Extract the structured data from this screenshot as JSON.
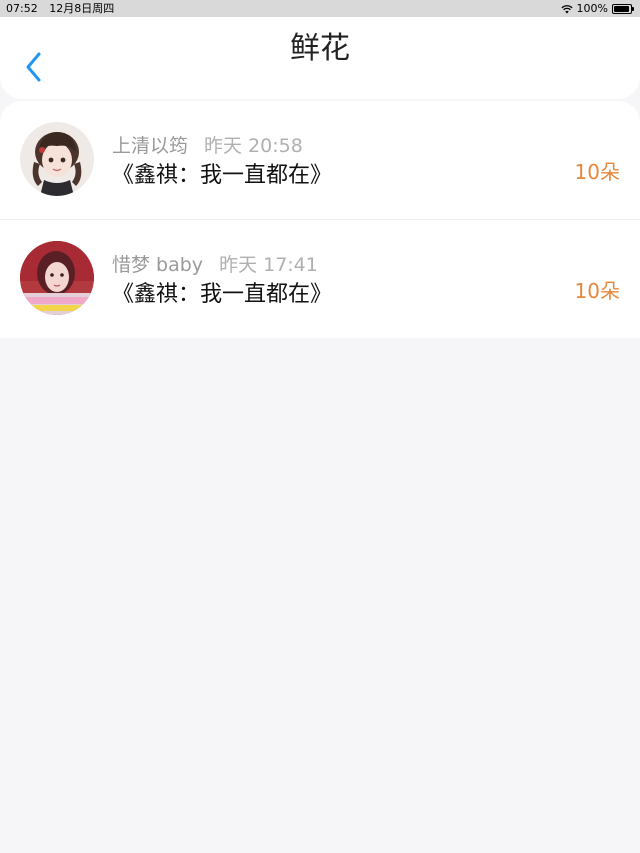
{
  "status_bar": {
    "time": "07:52",
    "date": "12月8日周四",
    "battery": "100%"
  },
  "nav": {
    "title": "鲜花",
    "back_icon": "chevron-left-icon",
    "accent_color": "#2196f3"
  },
  "flowers": [
    {
      "user": "上清以筠",
      "time": "昨天 20:58",
      "title": "《鑫祺：我一直都在》",
      "count": "10朵"
    },
    {
      "user": "惜梦 baby",
      "time": "昨天 17:41",
      "title": "《鑫祺：我一直都在》",
      "count": "10朵"
    }
  ],
  "colors": {
    "count_text": "#e8863a",
    "background": "#f6f5f7"
  }
}
